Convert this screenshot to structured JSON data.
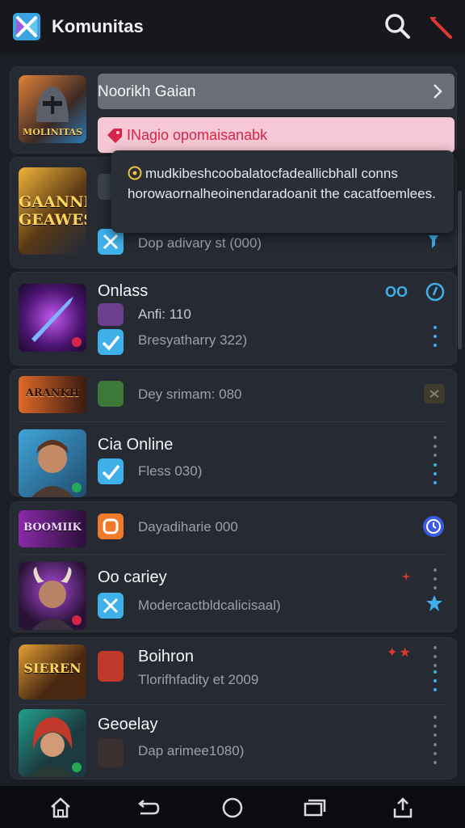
{
  "header": {
    "title": "Komunitas",
    "icons": {
      "logo": "app-logo-icon",
      "search": "search-icon",
      "wand": "magic-wand-icon"
    }
  },
  "banner": {
    "thumb_label": "MOLINITAS",
    "gray_text": "Noorikh Gaian",
    "pink_text": "INagio opomaisanabk"
  },
  "tooltip": {
    "text": "mudkibeshcoobalatocfadeallicbhall conns horowaornalheoinendaradoanit the cacatfoemlees."
  },
  "items": [
    {
      "thumb_label": "GAANNI GEAWES",
      "title": "",
      "sub": "Dop adivary st (000)"
    },
    {
      "title": "Onlass",
      "meta": "Anfi: 110",
      "sub": "Bresyatharry 322)",
      "badge": "OO"
    },
    {
      "thumb_label": "ARANKH",
      "sub": "Dey srimam: 080"
    },
    {
      "title": "Cia Online",
      "sub": "Fless 030)"
    },
    {
      "thumb_label": "BOOMIIK",
      "sub": "Dayadiharie 000"
    },
    {
      "title": "Oo cariey",
      "sub": "Modercactbldcalicisaal)"
    },
    {
      "thumb_label": "SIEREN",
      "title": "Boihron",
      "sub": "Tlorifhfadity et 2009"
    },
    {
      "title": "Geoelay",
      "sub": "Dap arimee1080)"
    }
  ],
  "nav": {
    "home": "home-icon",
    "back": "back-icon",
    "circle": "home-circle-icon",
    "recents": "recents-icon",
    "share": "share-icon"
  },
  "colors": {
    "accent": "#3fb0ea",
    "danger": "#d6254a",
    "surface": "#252a33"
  }
}
